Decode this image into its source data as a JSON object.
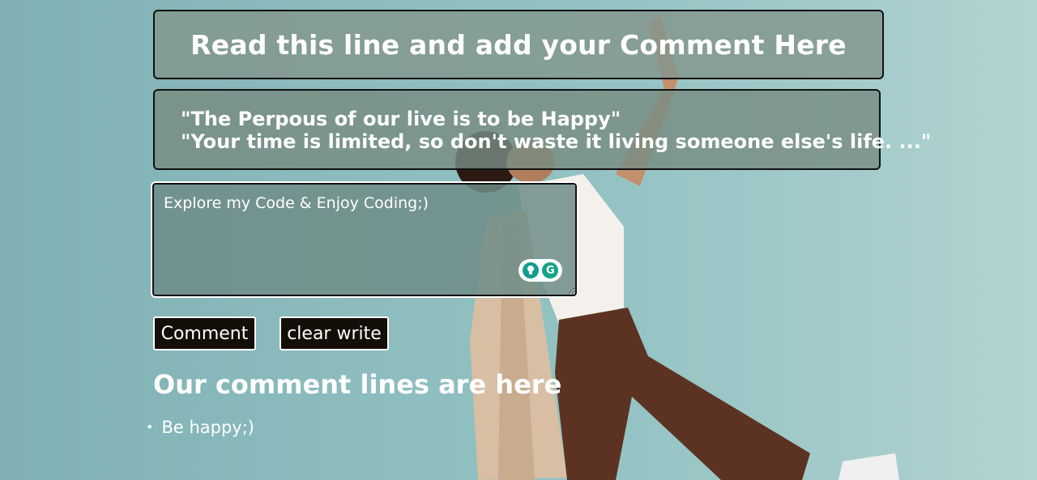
{
  "header": {
    "title": "Read this line and add your Comment Here"
  },
  "quotes": [
    "\"The Perpous of our live is to be Happy\"",
    "\"Your time is limited, so don't waste it living someone else's life. ...\""
  ],
  "comment_box": {
    "value": "Explore my Code & Enjoy Coding;)"
  },
  "grammarly": {
    "icons": [
      "lightbulb-icon",
      "grammarly-icon"
    ],
    "logo_letter": "G"
  },
  "buttons": {
    "comment_label": "Comment",
    "clear_label": "clear write"
  },
  "comments_section": {
    "title": "Our comment lines are here",
    "items": [
      "Be happy;)"
    ]
  },
  "colors": {
    "button_bg": "#140e08",
    "grammarly_green": "#15a388"
  }
}
